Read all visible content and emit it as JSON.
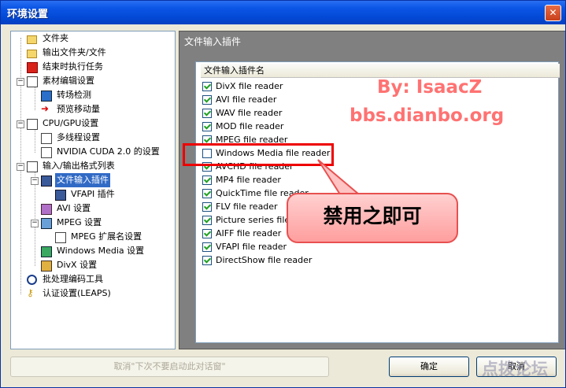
{
  "window": {
    "title": "环境设置",
    "close_label": "✕"
  },
  "tree": {
    "items": [
      {
        "label": "文件夹"
      },
      {
        "label": "输出文件夹/文件"
      },
      {
        "label": "结束时执行任务"
      },
      {
        "label": "素材编辑设置"
      },
      {
        "label": "转场检测"
      },
      {
        "label": "预览移动量"
      },
      {
        "label": "CPU/GPU设置"
      },
      {
        "label": "多线程设置"
      },
      {
        "label": "NVIDIA CUDA 2.0 的设置"
      },
      {
        "label": "输入/输出格式列表"
      },
      {
        "label": "文件输入插件"
      },
      {
        "label": "VFAPI 插件"
      },
      {
        "label": "AVI 设置"
      },
      {
        "label": "MPEG 设置"
      },
      {
        "label": "MPEG 扩展名设置"
      },
      {
        "label": "Windows Media 设置"
      },
      {
        "label": "DivX 设置"
      },
      {
        "label": "批处理编码工具"
      },
      {
        "label": "认证设置(LEAPS)"
      }
    ]
  },
  "panel": {
    "title": "文件输入插件",
    "column_header": "文件输入插件名",
    "plugins": [
      {
        "label": "DivX file reader",
        "checked": true
      },
      {
        "label": "AVI file reader",
        "checked": true
      },
      {
        "label": "WAV file reader",
        "checked": true
      },
      {
        "label": "MOD file reader",
        "checked": true
      },
      {
        "label": "MPEG file reader",
        "checked": true
      },
      {
        "label": "Windows Media file reader",
        "checked": false
      },
      {
        "label": "AVCHD file reader",
        "checked": true
      },
      {
        "label": "MP4 file reader",
        "checked": true
      },
      {
        "label": "QuickTime file reader",
        "checked": true
      },
      {
        "label": "FLV file reader",
        "checked": true
      },
      {
        "label": "Picture series file reader",
        "checked": true
      },
      {
        "label": "AIFF file reader",
        "checked": true
      },
      {
        "label": "VFAPI file reader",
        "checked": true
      },
      {
        "label": "DirectShow file reader",
        "checked": true
      }
    ]
  },
  "annotations": {
    "watermark_line1": "By: IsaacZ",
    "watermark_line2": "bbs.dianbo.org",
    "callout_text": "禁用之即可",
    "corner_watermark": "点拨论坛"
  },
  "footer": {
    "cancel_dont_show": "取消\"下次不要启动此对话窗\"",
    "ok": "确定",
    "cancel": "取消"
  },
  "colors": {
    "selection": "#316ac5",
    "title_bar": "#0c56e6",
    "highlight_box": "#ee0000",
    "panel_bg": "#808080"
  }
}
